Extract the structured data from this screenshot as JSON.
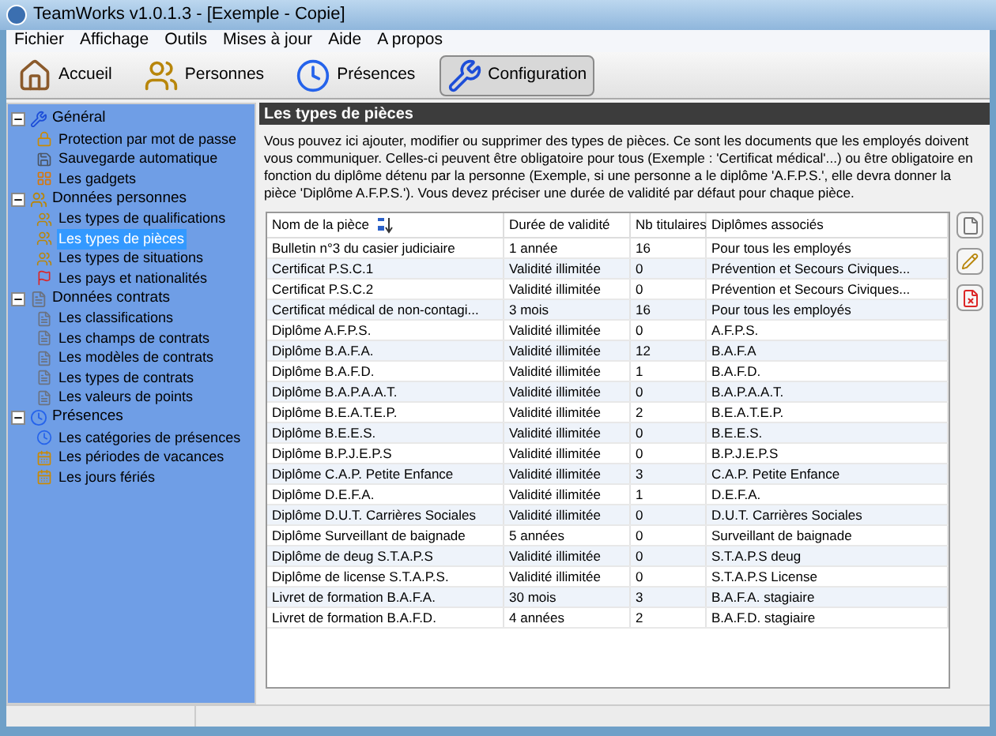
{
  "window": {
    "title": "TeamWorks v1.0.1.3 - [Exemple - Copie]"
  },
  "menu": [
    "Fichier",
    "Affichage",
    "Outils",
    "Mises à jour",
    "Aide",
    "A propos"
  ],
  "toolbar": [
    {
      "label": "Accueil",
      "kind": "home",
      "selected": false
    },
    {
      "label": "Personnes",
      "kind": "people",
      "selected": false
    },
    {
      "label": "Présences",
      "kind": "clock",
      "selected": false
    },
    {
      "label": "Configuration",
      "kind": "tools",
      "selected": true
    }
  ],
  "tree": [
    {
      "label": "Général",
      "kind": "tools",
      "expanded": true,
      "children": [
        {
          "label": "Protection par mot de passe",
          "kind": "lock",
          "selected": false
        },
        {
          "label": "Sauvegarde automatique",
          "kind": "disk",
          "selected": false
        },
        {
          "label": "Les gadgets",
          "kind": "gadget",
          "selected": false
        }
      ]
    },
    {
      "label": "Données personnes",
      "kind": "people",
      "expanded": true,
      "children": [
        {
          "label": "Les types de qualifications",
          "kind": "people",
          "selected": false
        },
        {
          "label": "Les types de pièces",
          "kind": "people",
          "selected": true
        },
        {
          "label": "Les types de situations",
          "kind": "people",
          "selected": false
        },
        {
          "label": "Les pays et nationalités",
          "kind": "flag",
          "selected": false
        }
      ]
    },
    {
      "label": "Données contrats",
      "kind": "doc",
      "expanded": true,
      "children": [
        {
          "label": "Les classifications",
          "kind": "doc",
          "selected": false
        },
        {
          "label": "Les champs de contrats",
          "kind": "doc",
          "selected": false
        },
        {
          "label": "Les modèles de contrats",
          "kind": "doc",
          "selected": false
        },
        {
          "label": "Les types de contrats",
          "kind": "doc",
          "selected": false
        },
        {
          "label": "Les valeurs de points",
          "kind": "doc",
          "selected": false
        }
      ]
    },
    {
      "label": "Présences",
      "kind": "clock",
      "expanded": true,
      "children": [
        {
          "label": "Les catégories de présences",
          "kind": "clock",
          "selected": false
        },
        {
          "label": "Les périodes de vacances",
          "kind": "calendar",
          "selected": false
        },
        {
          "label": "Les jours fériés",
          "kind": "calendar",
          "selected": false
        }
      ]
    }
  ],
  "panel": {
    "title": "Les types de pièces",
    "description": "Vous pouvez ici ajouter, modifier ou supprimer des types de pièces. Ce sont les documents que les employés doivent vous communiquer. Celles-ci peuvent être obligatoire pour tous (Exemple : 'Certificat médical'...) ou être obligatoire en fonction du diplôme détenu par la personne (Exemple, si une personne a le diplôme 'A.F.P.S.', elle devra donner la pièce 'Diplôme A.F.P.S.'). Vous devez préciser une durée de validité par défaut pour chaque pièce."
  },
  "table": {
    "columns": [
      "Nom de la pièce",
      "Durée de validité",
      "Nb titulaires",
      "Diplômes associés"
    ],
    "rows": [
      [
        "Bulletin n°3 du casier judiciaire",
        "1 année",
        "16",
        "Pour tous les employés"
      ],
      [
        "Certificat P.S.C.1",
        "Validité illimitée",
        "0",
        "Prévention et Secours Civiques..."
      ],
      [
        "Certificat P.S.C.2",
        "Validité illimitée",
        "0",
        "Prévention et Secours Civiques..."
      ],
      [
        "Certificat médical de non-contagi...",
        "3 mois",
        "16",
        "Pour tous les employés"
      ],
      [
        "Diplôme A.F.P.S.",
        "Validité illimitée",
        "0",
        "A.F.P.S."
      ],
      [
        "Diplôme B.A.F.A.",
        "Validité illimitée",
        "12",
        "B.A.F.A"
      ],
      [
        "Diplôme B.A.F.D.",
        "Validité illimitée",
        "1",
        "B.A.F.D."
      ],
      [
        "Diplôme B.A.P.A.A.T.",
        "Validité illimitée",
        "0",
        "B.A.P.A.A.T."
      ],
      [
        "Diplôme B.E.A.T.E.P.",
        "Validité illimitée",
        "2",
        "B.E.A.T.E.P."
      ],
      [
        "Diplôme B.E.E.S.",
        "Validité illimitée",
        "0",
        "B.E.E.S."
      ],
      [
        "Diplôme B.P.J.E.P.S",
        "Validité illimitée",
        "0",
        "B.P.J.E.P.S"
      ],
      [
        "Diplôme C.A.P. Petite Enfance",
        "Validité illimitée",
        "3",
        "C.A.P. Petite Enfance"
      ],
      [
        "Diplôme D.E.F.A.",
        "Validité illimitée",
        "1",
        "D.E.F.A."
      ],
      [
        "Diplôme D.U.T. Carrières Sociales",
        "Validité illimitée",
        "0",
        "D.U.T. Carrières Sociales"
      ],
      [
        "Diplôme Surveillant de baignade",
        "5 années",
        "0",
        "Surveillant de baignade"
      ],
      [
        "Diplôme de deug S.T.A.P.S",
        "Validité illimitée",
        "0",
        "S.T.A.P.S deug"
      ],
      [
        "Diplôme de license S.T.A.P.S.",
        "Validité illimitée",
        "0",
        "S.T.A.P.S License"
      ],
      [
        "Livret de formation B.A.F.A.",
        "30 mois",
        "3",
        "B.A.F.A. stagiaire"
      ],
      [
        "Livret de formation B.A.F.D.",
        "4 années",
        "2",
        "B.A.F.D. stagiaire"
      ]
    ]
  }
}
